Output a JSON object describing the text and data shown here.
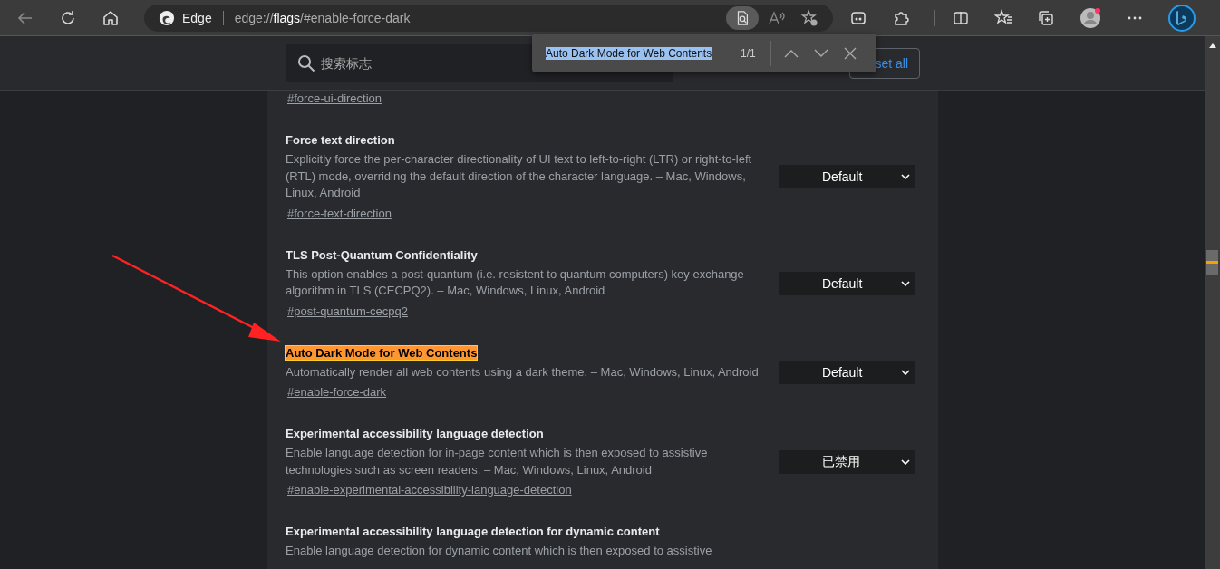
{
  "address_bar": {
    "site": "Edge",
    "url": "edge://**flags**/#enable-force-dark"
  },
  "find_bar": {
    "query": "Auto Dark Mode for Web Contents",
    "count": "1/1"
  },
  "search": {
    "placeholder": "搜索标志"
  },
  "reset_button": "set all",
  "flags": [
    {
      "link": "#force-ui-direction"
    },
    {
      "title": "Force text direction",
      "description": "Explicitly force the per-character directionality of UI text to left-to-right (LTR) or right-to-left (RTL) mode, overriding the default direction of the character language. – Mac, Windows, Linux, Android",
      "link": "#force-text-direction",
      "value": "Default",
      "highlighted": false
    },
    {
      "title": "TLS Post-Quantum Confidentiality",
      "description": "This option enables a post-quantum (i.e. resistent to quantum computers) key exchange algorithm in TLS (CECPQ2). – Mac, Windows, Linux, Android",
      "link": "#post-quantum-cecpq2",
      "value": "Default",
      "highlighted": false
    },
    {
      "title": "Auto Dark Mode for Web Contents",
      "description": "Automatically render all web contents using a dark theme. – Mac, Windows, Linux, Android",
      "link": "#enable-force-dark",
      "value": "Default",
      "highlighted": true
    },
    {
      "title": "Experimental accessibility language detection",
      "description": "Enable language detection for in-page content which is then exposed to assistive technologies such as screen readers. – Mac, Windows, Linux, Android",
      "link": "#enable-experimental-accessibility-language-detection",
      "value": "已禁用",
      "highlighted": false
    },
    {
      "title": "Experimental accessibility language detection for dynamic content",
      "description": "Enable language detection for dynamic content which is then exposed to assistive",
      "highlighted": false
    }
  ]
}
